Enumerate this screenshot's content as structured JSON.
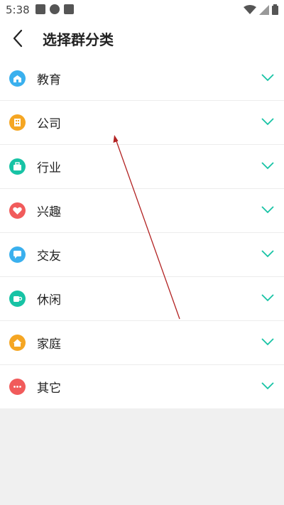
{
  "status_bar": {
    "time": "5:38"
  },
  "header": {
    "title": "选择群分类"
  },
  "categories": [
    {
      "label": "教育",
      "icon": "school-icon",
      "color": "#3ab0ee"
    },
    {
      "label": "公司",
      "icon": "building-icon",
      "color": "#f5a623"
    },
    {
      "label": "行业",
      "icon": "briefcase-icon",
      "color": "#17c3a5"
    },
    {
      "label": "兴趣",
      "icon": "heart-icon",
      "color": "#f15b5b"
    },
    {
      "label": "交友",
      "icon": "chat-icon",
      "color": "#3ab0ee"
    },
    {
      "label": "休闲",
      "icon": "coffee-cup-icon",
      "color": "#17c3a5"
    },
    {
      "label": "家庭",
      "icon": "house-icon",
      "color": "#f5a623"
    },
    {
      "label": "其它",
      "icon": "more-icon",
      "color": "#f15b5b"
    }
  ],
  "colors": {
    "chevron": "#17c3a5",
    "annotation_arrow": "#b22222"
  }
}
